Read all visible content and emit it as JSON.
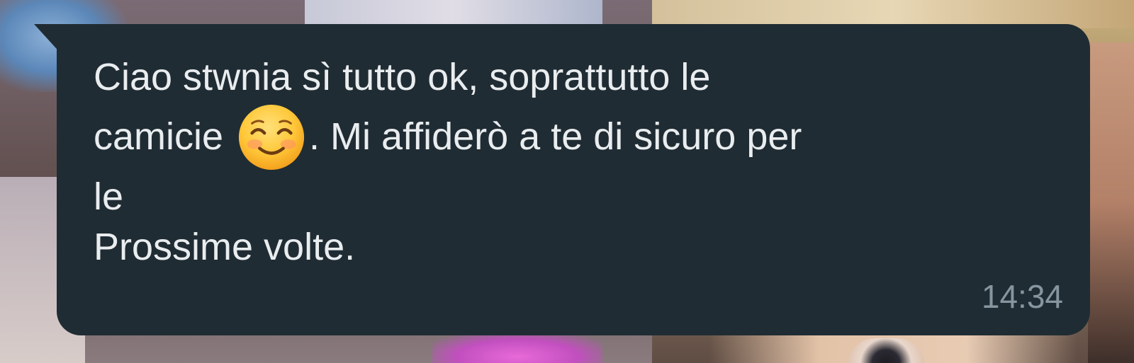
{
  "message": {
    "line1": "Ciao stwnia sì tutto ok, soprattutto le",
    "line2_before_emoji": "camicie ",
    "emoji": "smiling-face-with-smiling-eyes",
    "line2_after_emoji": ". Mi affiderò a te di sicuro per",
    "line3": "le",
    "line4": "Prossime volte.",
    "time": "14:34"
  },
  "colors": {
    "bubble": "#202c33",
    "text": "#e9edef",
    "timestamp": "#8696a0"
  }
}
